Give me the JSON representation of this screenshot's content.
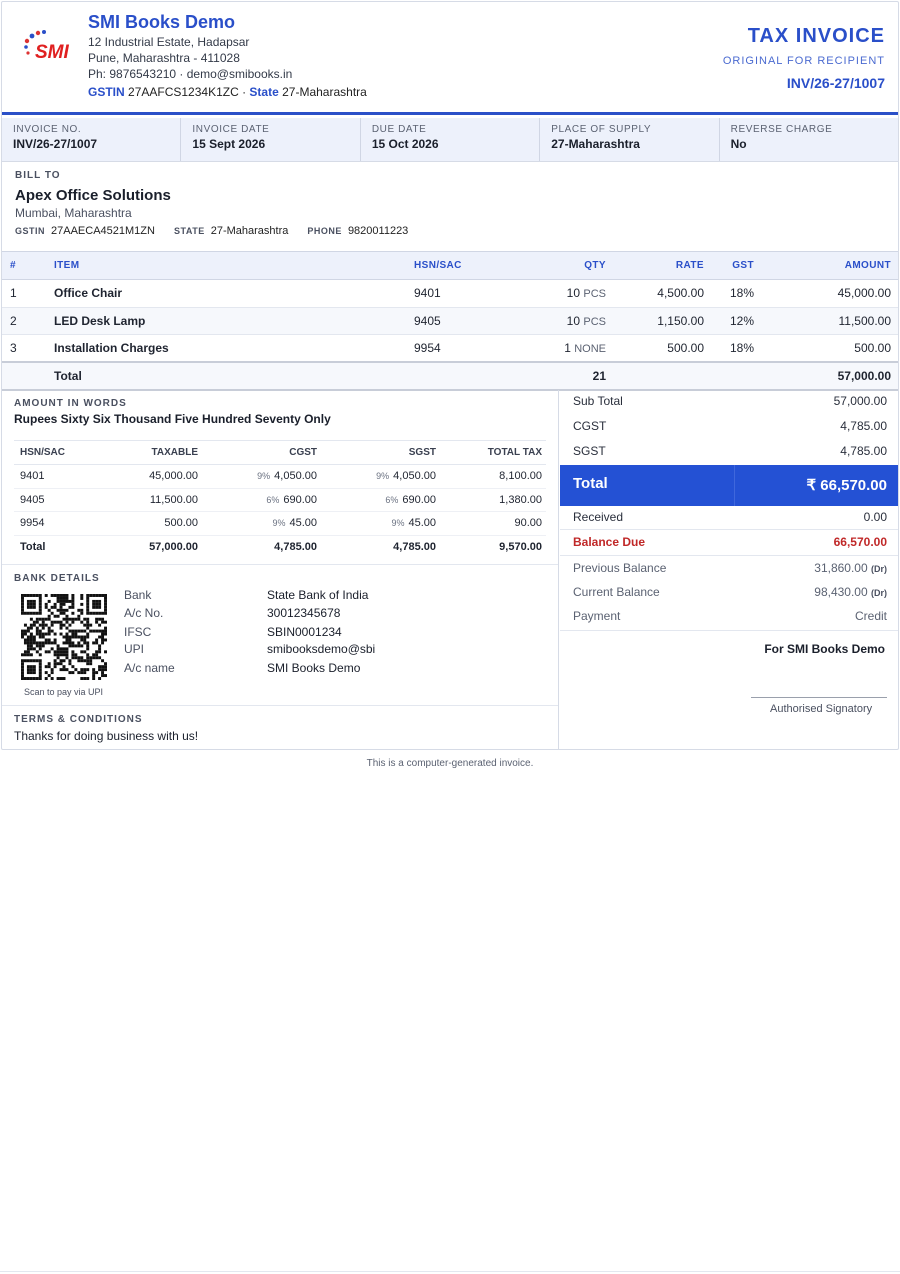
{
  "company": {
    "name": "SMI Books Demo",
    "logo_text": "SMI",
    "address1": "12 Industrial Estate, Hadapsar",
    "address2": "Pune, Maharashtra - 411028",
    "contact": "Ph: 9876543210 · demo@smibooks.in",
    "gstin_label": "GSTIN",
    "gstin": "27AAFCS1234K1ZC",
    "sep": " · ",
    "state_label": "State",
    "state": "27-Maharashtra"
  },
  "doc": {
    "title": "TAX INVOICE",
    "copy": "ORIGINAL FOR RECIPIENT",
    "number": "INV/26-27/1007"
  },
  "meta": [
    {
      "label": "INVOICE NO.",
      "value": "INV/26-27/1007"
    },
    {
      "label": "INVOICE DATE",
      "value": "15 Sept 2026"
    },
    {
      "label": "DUE DATE",
      "value": "15 Oct 2026"
    },
    {
      "label": "PLACE OF SUPPLY",
      "value": "27-Maharashtra"
    },
    {
      "label": "REVERSE CHARGE",
      "value": "No"
    }
  ],
  "bill_to": {
    "label": "BILL TO",
    "name": "Apex Office Solutions",
    "city": "Mumbai, Maharashtra",
    "gstin_label": "GSTIN",
    "gstin": "27AAECA4521M1ZN",
    "state_label": "STATE",
    "state": "27-Maharashtra",
    "phone_label": "PHONE",
    "phone": "9820011223"
  },
  "items": {
    "headers": {
      "no": "#",
      "item": "ITEM",
      "hsn": "HSN/SAC",
      "qty": "QTY",
      "rate": "RATE",
      "gst": "GST",
      "amount": "AMOUNT"
    },
    "rows": [
      {
        "no": "1",
        "item": "Office Chair",
        "hsn": "9401",
        "qty": "10",
        "unit": "PCS",
        "rate": "4,500.00",
        "gst": "18%",
        "amount": "45,000.00"
      },
      {
        "no": "2",
        "item": "LED Desk Lamp",
        "hsn": "9405",
        "qty": "10",
        "unit": "PCS",
        "rate": "1,150.00",
        "gst": "12%",
        "amount": "11,500.00"
      },
      {
        "no": "3",
        "item": "Installation Charges",
        "hsn": "9954",
        "qty": "1",
        "unit": "NONE",
        "rate": "500.00",
        "gst": "18%",
        "amount": "500.00"
      }
    ],
    "total_label": "Total",
    "total_qty": "21",
    "total_amount": "57,000.00"
  },
  "amount_words": {
    "label": "AMOUNT IN WORDS",
    "text": "Rupees Sixty Six Thousand Five Hundred Seventy Only"
  },
  "hsn_summary": {
    "headers": {
      "hsn": "HSN/SAC",
      "taxable": "TAXABLE",
      "cgst": "CGST",
      "sgst": "SGST",
      "total": "TOTAL TAX"
    },
    "rows": [
      {
        "hsn": "9401",
        "taxable": "45,000.00",
        "cgst_rate": "9%",
        "cgst": "4,050.00",
        "sgst_rate": "9%",
        "sgst": "4,050.00",
        "total": "8,100.00"
      },
      {
        "hsn": "9405",
        "taxable": "11,500.00",
        "cgst_rate": "6%",
        "cgst": "690.00",
        "sgst_rate": "6%",
        "sgst": "690.00",
        "total": "1,380.00"
      },
      {
        "hsn": "9954",
        "taxable": "500.00",
        "cgst_rate": "9%",
        "cgst": "45.00",
        "sgst_rate": "9%",
        "sgst": "45.00",
        "total": "90.00"
      }
    ],
    "total": {
      "label": "Total",
      "taxable": "57,000.00",
      "cgst": "4,785.00",
      "sgst": "4,785.00",
      "total": "9,570.00"
    }
  },
  "bank": {
    "label": "BANK DETAILS",
    "qr_caption": "Scan to pay via UPI",
    "rows": [
      {
        "k": "Bank",
        "v": "State Bank of India"
      },
      {
        "k": "A/c No.",
        "v": "30012345678"
      },
      {
        "k": "IFSC",
        "v": "SBIN0001234"
      },
      {
        "k": "UPI",
        "v": "smibooksdemo@sbi"
      },
      {
        "k": "A/c name",
        "v": "SMI Books Demo"
      }
    ]
  },
  "terms": {
    "label": "TERMS & CONDITIONS",
    "text": "Thanks for doing business with us!"
  },
  "summary": {
    "sub_total_label": "Sub Total",
    "sub_total": "57,000.00",
    "cgst_label": "CGST",
    "cgst": "4,785.00",
    "sgst_label": "SGST",
    "sgst": "4,785.00",
    "total_label": "Total",
    "total": "₹ 66,570.00",
    "received_label": "Received",
    "received": "0.00",
    "balance_label": "Balance Due",
    "balance": "66,570.00",
    "prev_label": "Previous Balance",
    "prev": "31,860.00",
    "prev_dr": "(Dr)",
    "curr_label": "Current Balance",
    "curr": "98,430.00",
    "curr_dr": "(Dr)",
    "payment_label": "Payment",
    "payment": "Credit"
  },
  "signature": {
    "for": "For SMI Books Demo",
    "label": "Authorised Signatory"
  },
  "footer": "This is a computer-generated invoice.",
  "colors": {
    "accent": "#2a4fc9",
    "total_bg": "#2451d4",
    "balance": "#c02828"
  }
}
